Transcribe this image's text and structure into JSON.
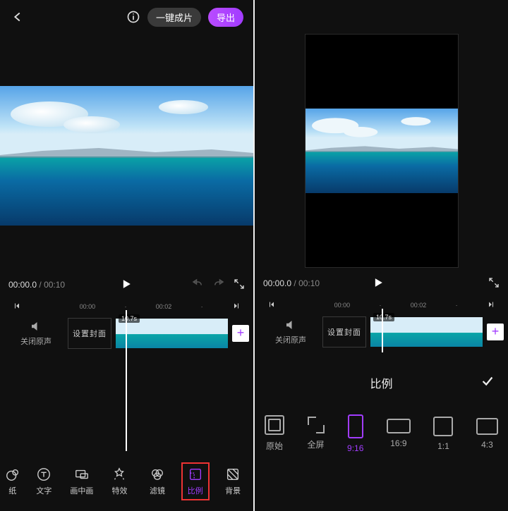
{
  "header": {
    "one_click_label": "一键成片",
    "export_label": "导出"
  },
  "playbar": {
    "position": "00:00.0",
    "duration": "00:10"
  },
  "jumpbar": {
    "start_tick": "00:00",
    "mid_tick": "00:02"
  },
  "timeline": {
    "audio_off_label": "关闭原声",
    "cover_label": "设置封面",
    "clip_duration": "10.7s"
  },
  "tools": {
    "paper": "纸",
    "text": "文字",
    "pip": "画中画",
    "fx": "特效",
    "filter": "滤镜",
    "ratio": "比例",
    "bg": "背景"
  },
  "ratio_panel": {
    "title": "比例",
    "opts": {
      "original": "原始",
      "fullscreen": "全屏",
      "r916": "9:16",
      "r169": "16:9",
      "r11": "1:1",
      "r43": "4:3"
    }
  },
  "colors": {
    "accent": "#a23cff",
    "highlight": "#e33"
  }
}
